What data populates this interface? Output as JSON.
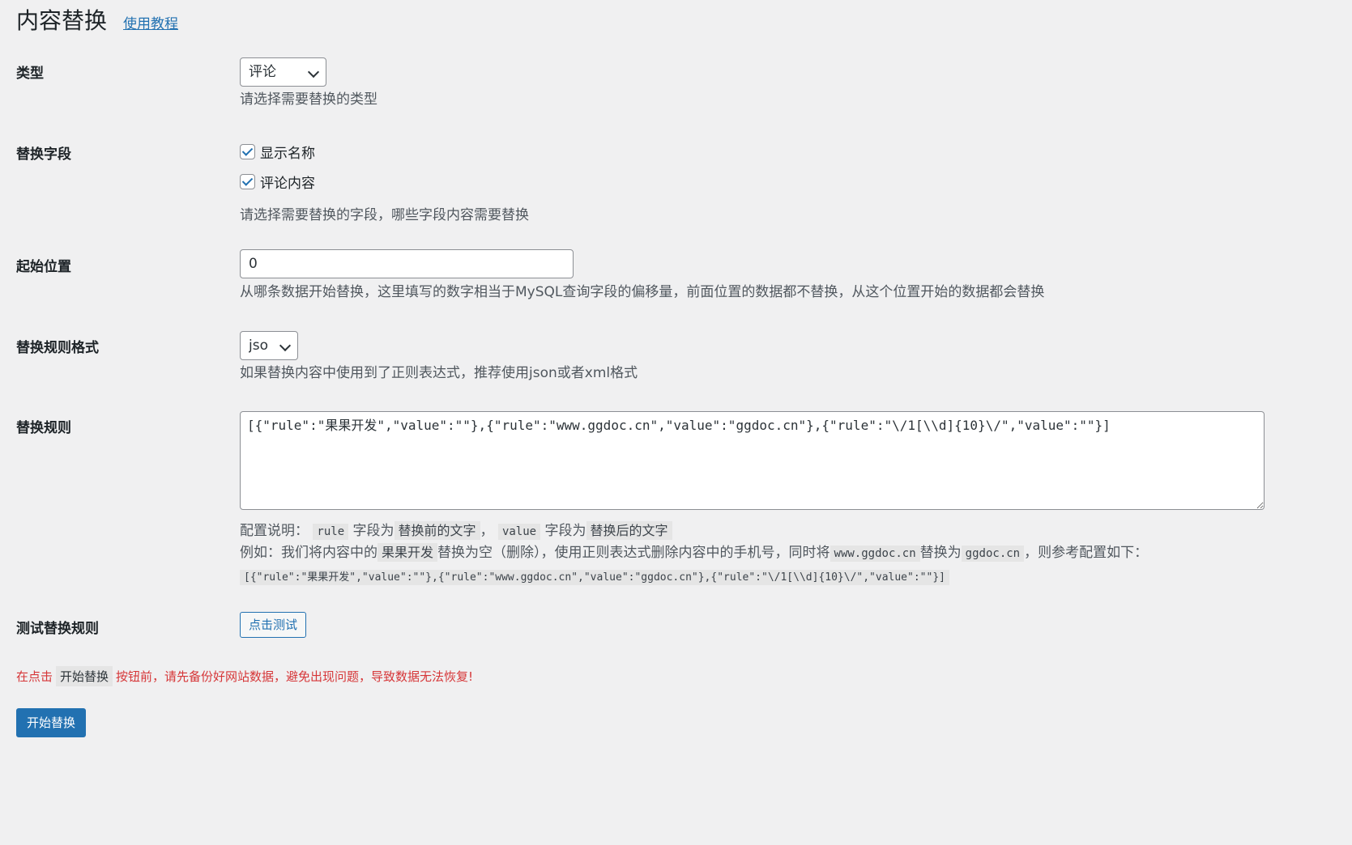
{
  "header": {
    "title": "内容替换",
    "help_link": "使用教程"
  },
  "type_row": {
    "label": "类型",
    "selected": "评论",
    "description": "请选择需要替换的类型"
  },
  "fields_row": {
    "label": "替换字段",
    "options": [
      {
        "label": "显示名称",
        "checked": true
      },
      {
        "label": "评论内容",
        "checked": true
      }
    ],
    "description": "请选择需要替换的字段，哪些字段内容需要替换"
  },
  "offset_row": {
    "label": "起始位置",
    "value": "0",
    "description": "从哪条数据开始替换，这里填写的数字相当于MySQL查询字段的偏移量，前面位置的数据都不替换，从这个位置开始的数据都会替换"
  },
  "format_row": {
    "label": "替换规则格式",
    "selected": "json",
    "description": "如果替换内容中使用到了正则表达式，推荐使用json或者xml格式"
  },
  "rules_row": {
    "label": "替换规则",
    "value": "[{\"rule\":\"果果开发\",\"value\":\"\"},{\"rule\":\"www.ggdoc.cn\",\"value\":\"ggdoc.cn\"},{\"rule\":\"\\/1[\\\\d]{10}\\/\",\"value\":\"\"}]",
    "config_prefix": "配置说明：",
    "code_rule": "rule",
    "text_field_is": "字段为",
    "code_before": "替换前的文字",
    "comma": "，",
    "code_value": "value",
    "text_field_is_2": "字段为",
    "code_after": "替换后的文字",
    "example_prefix": "例如：我们将内容中的",
    "code_example_word": "果果开发",
    "example_mid1": "替换为空（删除），使用正则表达式删除内容中的手机号，同时将",
    "code_domain": "www.ggdoc.cn",
    "example_mid2": "替换为",
    "code_domain2": "ggdoc.cn",
    "example_suffix": "，则参考配置如下：",
    "example_config": "[{\"rule\":\"果果开发\",\"value\":\"\"},{\"rule\":\"www.ggdoc.cn\",\"value\":\"ggdoc.cn\"},{\"rule\":\"\\/1[\\\\d]{10}\\/\",\"value\":\"\"}]"
  },
  "test_row": {
    "label": "测试替换规则",
    "button": "点击测试"
  },
  "warning": {
    "prefix": "在点击",
    "code": "开始替换",
    "suffix": "按钮前，请先备份好网站数据，避免出现问题，导致数据无法恢复!"
  },
  "submit_button": "开始替换",
  "colors": {
    "background": "#f0f0f1",
    "accent": "#2271b1",
    "warning": "#d63638"
  }
}
